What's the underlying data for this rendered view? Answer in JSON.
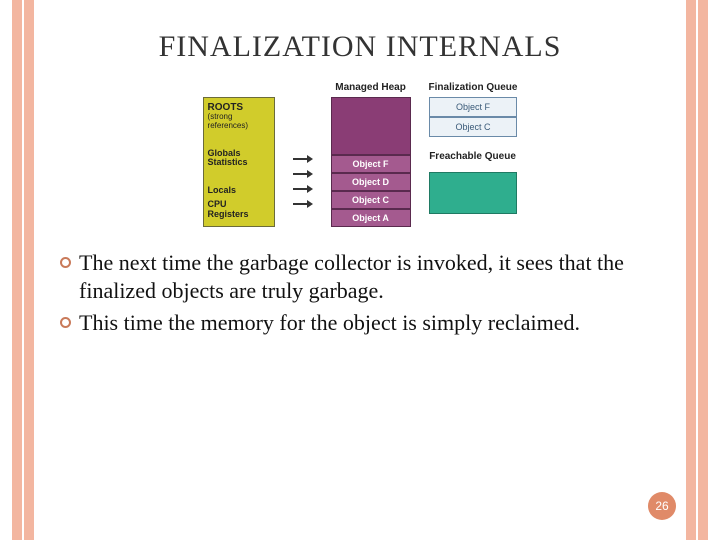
{
  "title": "FINALIZATION INTERNALS",
  "diagram": {
    "roots": {
      "title": "ROOTS",
      "subtitle": "(strong references)",
      "items": [
        "Globals Statistics",
        "Locals",
        "CPU Registers"
      ]
    },
    "heap": {
      "label": "Managed Heap",
      "cells": [
        "Object F",
        "Object D",
        "Object C",
        "Object A"
      ]
    },
    "finalization_queue": {
      "label": "Finalization Queue",
      "cells": [
        "Object F",
        "Object C"
      ]
    },
    "freachable": {
      "label": "Freachable Queue"
    }
  },
  "bullets": [
    "The next time the garbage collector is invoked, it sees that the finalized objects are truly garbage.",
    "This time the memory for the object is simply reclaimed."
  ],
  "page_number": "26"
}
